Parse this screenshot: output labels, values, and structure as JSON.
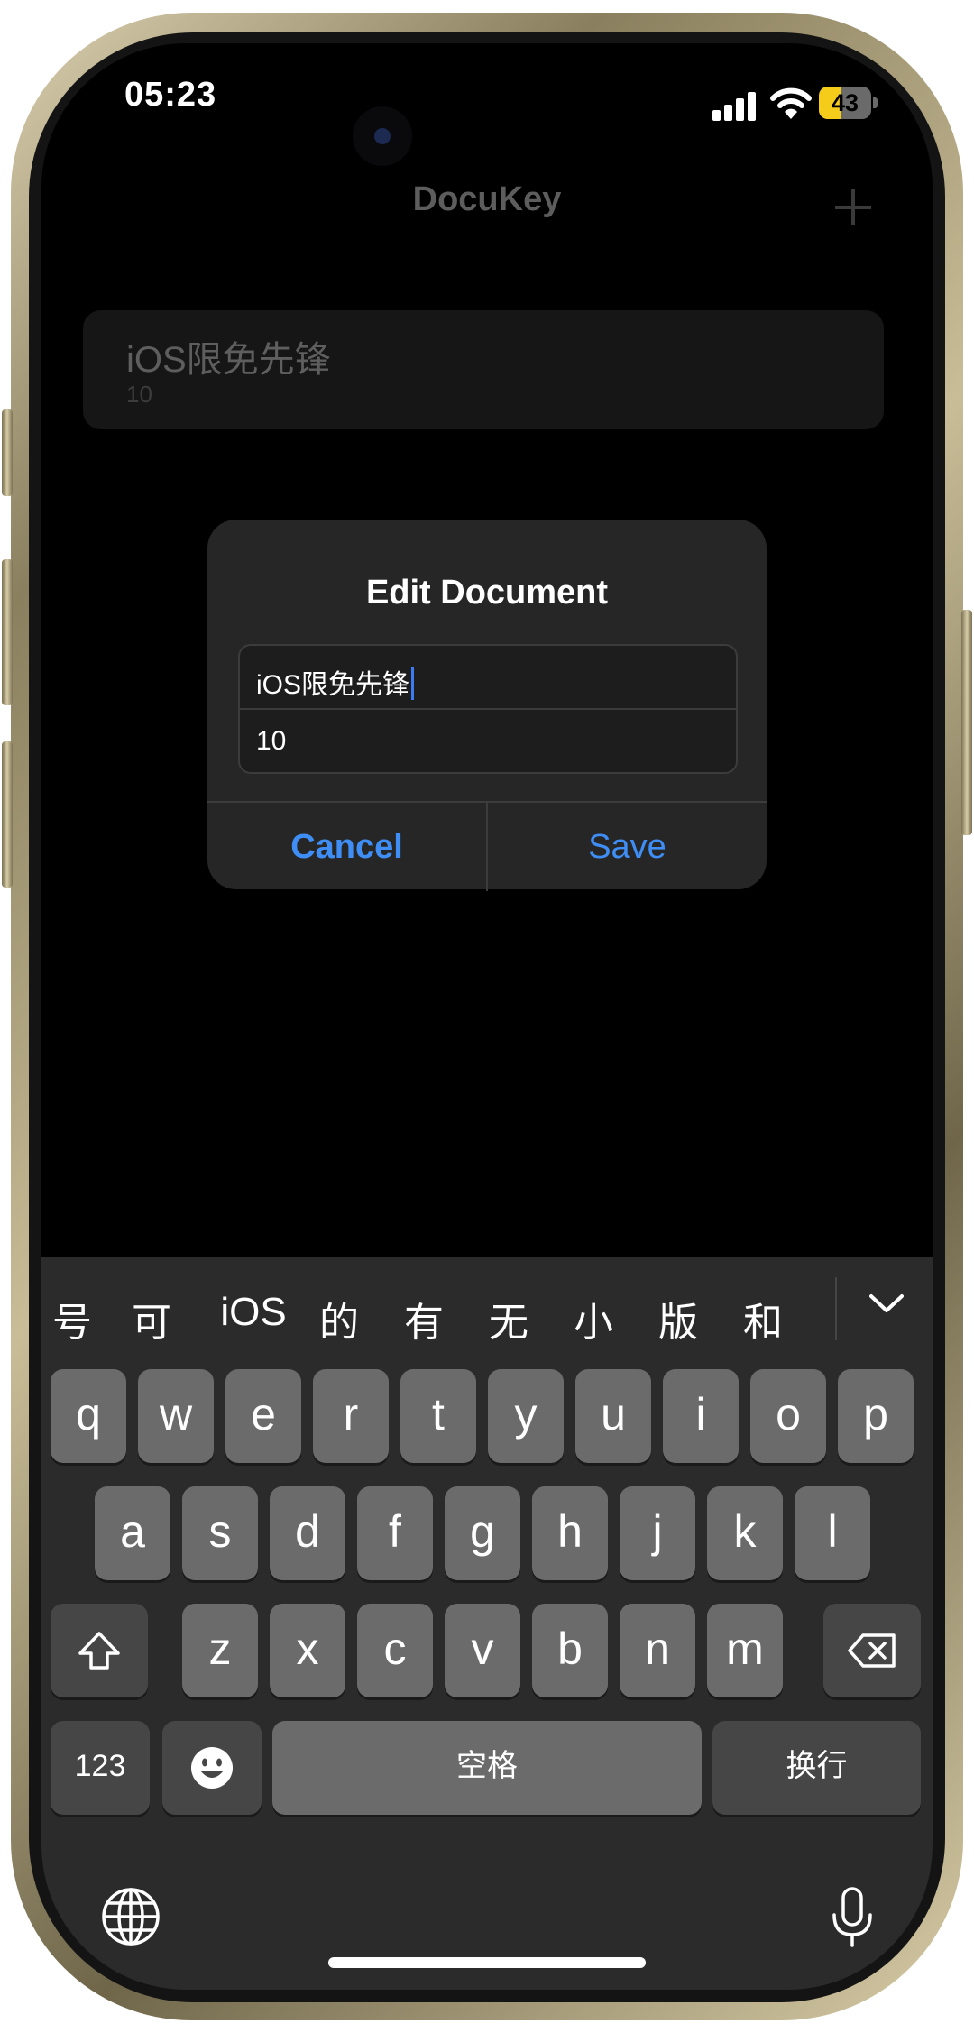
{
  "status_bar": {
    "time": "05:23",
    "battery_level": "43"
  },
  "app": {
    "title": "DocuKey",
    "add_icon": "plus-icon",
    "documents": [
      {
        "name": "iOS限免先锋",
        "count": "10"
      }
    ]
  },
  "dialog": {
    "title": "Edit Document",
    "name_value": "iOS限免先锋",
    "count_value": "10",
    "cancel_label": "Cancel",
    "save_label": "Save"
  },
  "keyboard": {
    "candidates": [
      "号",
      "可",
      "iOS",
      "的",
      "有",
      "无",
      "小",
      "版",
      "和"
    ],
    "row1": [
      "q",
      "w",
      "e",
      "r",
      "t",
      "y",
      "u",
      "i",
      "o",
      "p"
    ],
    "row2": [
      "a",
      "s",
      "d",
      "f",
      "g",
      "h",
      "j",
      "k",
      "l"
    ],
    "row3": [
      "z",
      "x",
      "c",
      "v",
      "b",
      "n",
      "m"
    ],
    "numbers_label": "123",
    "space_label": "空格",
    "return_label": "换行",
    "icons": [
      "shift-icon",
      "delete-icon",
      "emoji-icon",
      "globe-icon",
      "microphone-icon",
      "chevron-down-icon"
    ]
  },
  "colors": {
    "accent": "#3f8ef5",
    "battery": "#f5cc1a",
    "caret": "#3b7cf2"
  }
}
